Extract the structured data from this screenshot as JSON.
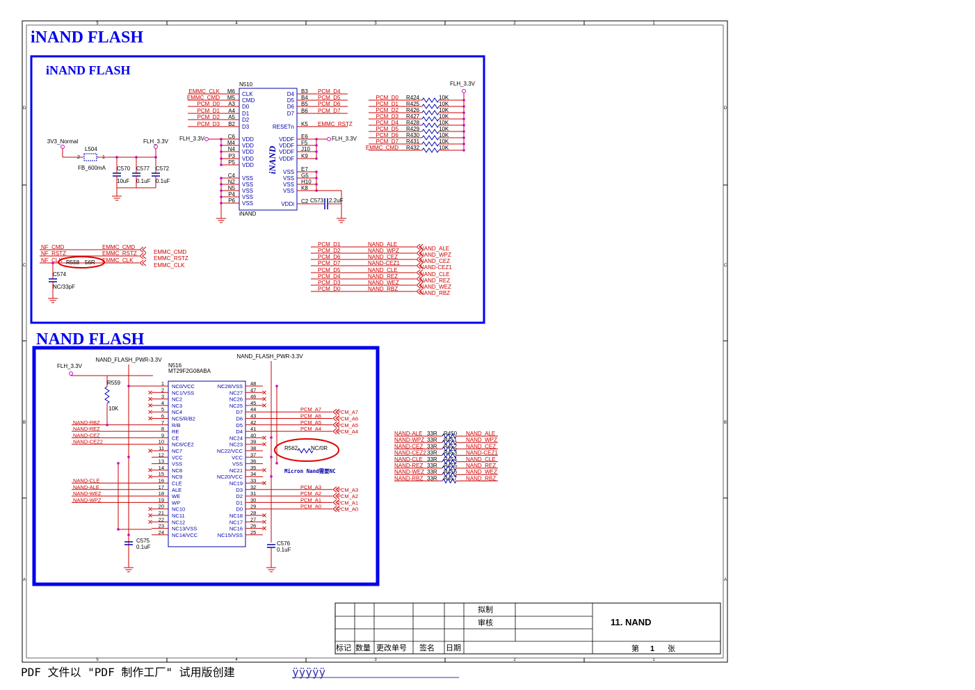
{
  "colors": {
    "wire": "#cc0000",
    "sym": "#0000aa",
    "frame": "#0000ee",
    "pin": "#cc00cc",
    "text": "#000000"
  },
  "border": {
    "cols": [
      "5",
      "4",
      "3",
      "2",
      "1"
    ],
    "rows": [
      "D",
      "C",
      "B",
      "A"
    ]
  },
  "sheet_title": "iNAND FLASH",
  "inand": {
    "title": "iNAND FLASH",
    "ic": {
      "ref": "N510",
      "name": "iNAND",
      "logo": "iNAND"
    },
    "left_pins": [
      {
        "sig": "EMMC_CLK",
        "num": "M6",
        "name": "CLK"
      },
      {
        "sig": "EMMC_CMD",
        "num": "M5",
        "name": "CMD"
      },
      {
        "sig": "PCM_D0",
        "num": "A3",
        "name": "D0"
      },
      {
        "sig": "PCM_D1",
        "num": "A4",
        "name": "D1"
      },
      {
        "sig": "PCM_D2",
        "num": "A5",
        "name": "D2"
      },
      {
        "sig": "PCM_D3",
        "num": "B2",
        "name": "D3"
      },
      {
        "sig": "",
        "num": "C6",
        "name": "VDD"
      },
      {
        "sig": "",
        "num": "M4",
        "name": "VDD"
      },
      {
        "sig": "",
        "num": "N4",
        "name": "VDD"
      },
      {
        "sig": "",
        "num": "P3",
        "name": "VDD"
      },
      {
        "sig": "",
        "num": "P5",
        "name": "VDD"
      },
      {
        "sig": "",
        "num": "C4",
        "name": "VSS"
      },
      {
        "sig": "",
        "num": "N2",
        "name": "VSS"
      },
      {
        "sig": "",
        "num": "N5",
        "name": "VSS"
      },
      {
        "sig": "",
        "num": "P4",
        "name": "VSS"
      },
      {
        "sig": "",
        "num": "P6",
        "name": "VSS"
      }
    ],
    "right_pins": [
      {
        "name": "D4",
        "num": "B3",
        "sig": "PCM_D4"
      },
      {
        "name": "D5",
        "num": "B4",
        "sig": "PCM_D5"
      },
      {
        "name": "D6",
        "num": "B5",
        "sig": "PCM_D6"
      },
      {
        "name": "D7",
        "num": "B6",
        "sig": "PCM_D7"
      },
      {
        "name": "RESETn",
        "num": "K5",
        "sig": "EMMC_RSTZ"
      },
      {
        "name": "VDDF",
        "num": "E6",
        "sig": ""
      },
      {
        "name": "VDDF",
        "num": "F5",
        "sig": ""
      },
      {
        "name": "VDDF",
        "num": "J10",
        "sig": ""
      },
      {
        "name": "VDDF",
        "num": "K9",
        "sig": ""
      },
      {
        "name": "VSS",
        "num": "E7",
        "sig": ""
      },
      {
        "name": "VSS",
        "num": "G5",
        "sig": ""
      },
      {
        "name": "VSS",
        "num": "H10",
        "sig": ""
      },
      {
        "name": "VSS",
        "num": "K8",
        "sig": ""
      },
      {
        "name": "VDDi",
        "num": "C2",
        "sig": ""
      }
    ],
    "power_left": "FLH_3.3V",
    "power_right": "FLH_3.3V",
    "cap_vddi": {
      "ref": "C573",
      "val": "2.2uF"
    },
    "filter": {
      "src": "3V3_Normal",
      "dst": "FLH_3.3V",
      "ind_ref": "L504",
      "ind_val": "FB_600mA",
      "pin2": "2",
      "pin1": "1",
      "caps": [
        {
          "ref": "C570",
          "val": "10uF"
        },
        {
          "ref": "C577",
          "val": "0.1uF"
        },
        {
          "ref": "C572",
          "val": "0.1uF"
        }
      ]
    },
    "pullup_power": "FLH_3.3V",
    "pullups": [
      {
        "net": "PCM_D0",
        "ref": "R424",
        "val": "10K"
      },
      {
        "net": "PCM_D1",
        "ref": "R425",
        "val": "10K"
      },
      {
        "net": "PCM_D2",
        "ref": "R426",
        "val": "10K"
      },
      {
        "net": "PCM_D3",
        "ref": "R427",
        "val": "10K"
      },
      {
        "net": "PCM_D4",
        "ref": "R428",
        "val": "10K"
      },
      {
        "net": "PCM_D5",
        "ref": "R429",
        "val": "10K"
      },
      {
        "net": "PCM_D6",
        "ref": "R430",
        "val": "10K"
      },
      {
        "net": "PCM_D7",
        "ref": "R431",
        "val": "10K"
      },
      {
        "net": "EMMC_CMD",
        "ref": "R432",
        "val": "10K"
      }
    ],
    "map_left": [
      {
        "a": "NF_CMD",
        "b": "EMMC_CMD",
        "out": "EMMC_CMD"
      },
      {
        "a": "NF_RSTZ",
        "b": "EMMC_RSTZ",
        "out": "EMMC_RSTZ"
      },
      {
        "a": "NF_CLK",
        "b": "EMMC_CLK",
        "out": "EMMC_CLK"
      }
    ],
    "series_res": {
      "ref": "R558",
      "val": "56R"
    },
    "clk_cap": {
      "ref": "C574",
      "val": "NC/33pF"
    },
    "map_right": [
      {
        "a": "PCM_D1",
        "b": "NAND_ALE",
        "out": "NAND_ALE"
      },
      {
        "a": "PCM_D2",
        "b": "NAND_WPZ",
        "out": "NAND_WPZ"
      },
      {
        "a": "PCM_D6",
        "b": "NAND_CEZ",
        "out": "NAND_CEZ"
      },
      {
        "a": "PCM_D7",
        "b": "NAND-CEZ1",
        "out": "NAND-CEZ1"
      },
      {
        "a": "PCM_D5",
        "b": "NAND_CLE",
        "out": "NAND_CLE"
      },
      {
        "a": "PCM_D4",
        "b": "NAND_REZ",
        "out": "NAND_REZ"
      },
      {
        "a": "PCM_D3",
        "b": "NAND_WEZ",
        "out": "NAND_WEZ"
      },
      {
        "a": "PCM_D0",
        "b": "NAND_RBZ",
        "out": "NAND_RBZ"
      }
    ]
  },
  "nand": {
    "title": "NAND FLASH",
    "ic": {
      "ref": "N516",
      "part": "MT29F2G08ABA"
    },
    "power_left": "NAND_FLASH_PWR-3.3V",
    "power_right": "NAND_FLASH_PWR-3.3V",
    "flh": "FLH_3.3V",
    "pullup": {
      "ref": "R559",
      "val": "10K"
    },
    "left_pins": [
      {
        "n": "1",
        "name": "NC0/VCC",
        "sig": ""
      },
      {
        "n": "2",
        "name": "NC1/VSS",
        "sig": ""
      },
      {
        "n": "3",
        "name": "NC2",
        "sig": ""
      },
      {
        "n": "4",
        "name": "NC3",
        "sig": ""
      },
      {
        "n": "5",
        "name": "NC4",
        "sig": ""
      },
      {
        "n": "6",
        "name": "NC5/R/B2",
        "sig": ""
      },
      {
        "n": "7",
        "name": "R/B",
        "sig": "NAND-RBZ"
      },
      {
        "n": "8",
        "name": "RE",
        "sig": "NAND-REZ"
      },
      {
        "n": "9",
        "name": "CE",
        "sig": "NAND-CEZ"
      },
      {
        "n": "10",
        "name": "NC6/CE2",
        "sig": "NAND-CEZ2"
      },
      {
        "n": "11",
        "name": "NC7",
        "sig": ""
      },
      {
        "n": "12",
        "name": "VCC",
        "sig": ""
      },
      {
        "n": "13",
        "name": "VSS",
        "sig": ""
      },
      {
        "n": "14",
        "name": "NC8",
        "sig": ""
      },
      {
        "n": "15",
        "name": "NC9",
        "sig": ""
      },
      {
        "n": "16",
        "name": "CLE",
        "sig": "NAND-CLE"
      },
      {
        "n": "17",
        "name": "ALE",
        "sig": "NAND-ALE"
      },
      {
        "n": "18",
        "name": "WE",
        "sig": "NAND-WEZ"
      },
      {
        "n": "19",
        "name": "WP",
        "sig": "NAND-WPZ"
      },
      {
        "n": "20",
        "name": "NC10",
        "sig": ""
      },
      {
        "n": "21",
        "name": "NC11",
        "sig": ""
      },
      {
        "n": "22",
        "name": "NC12",
        "sig": ""
      },
      {
        "n": "23",
        "name": "NC13/VSS",
        "sig": ""
      },
      {
        "n": "24",
        "name": "NC14/VCC",
        "sig": ""
      }
    ],
    "right_pins": [
      {
        "n": "48",
        "name": "NC28/VSS",
        "sig": ""
      },
      {
        "n": "47",
        "name": "NC27",
        "sig": ""
      },
      {
        "n": "46",
        "name": "NC26",
        "sig": ""
      },
      {
        "n": "45",
        "name": "NC25",
        "sig": ""
      },
      {
        "n": "44",
        "name": "D7",
        "sig": "PCM_A7"
      },
      {
        "n": "43",
        "name": "D6",
        "sig": "PCM_A6"
      },
      {
        "n": "42",
        "name": "D5",
        "sig": "PCM_A5"
      },
      {
        "n": "41",
        "name": "D4",
        "sig": "PCM_A4"
      },
      {
        "n": "40",
        "name": "NC24",
        "sig": ""
      },
      {
        "n": "39",
        "name": "NC23",
        "sig": ""
      },
      {
        "n": "38",
        "name": "NC22/VCC",
        "sig": ""
      },
      {
        "n": "37",
        "name": "VCC",
        "sig": ""
      },
      {
        "n": "36",
        "name": "VSS",
        "sig": ""
      },
      {
        "n": "35",
        "name": "NC21",
        "sig": ""
      },
      {
        "n": "34",
        "name": "NC20/VCC",
        "sig": ""
      },
      {
        "n": "33",
        "name": "NC19",
        "sig": ""
      },
      {
        "n": "32",
        "name": "D3",
        "sig": "PCM_A3"
      },
      {
        "n": "31",
        "name": "D2",
        "sig": "PCM_A2"
      },
      {
        "n": "30",
        "name": "D1",
        "sig": "PCM_A1"
      },
      {
        "n": "29",
        "name": "D0",
        "sig": "PCM_A0"
      },
      {
        "n": "28",
        "name": "NC18",
        "sig": ""
      },
      {
        "n": "27",
        "name": "NC17",
        "sig": ""
      },
      {
        "n": "26",
        "name": "NC16",
        "sig": ""
      },
      {
        "n": "25",
        "name": "NC15/VSS",
        "sig": ""
      }
    ],
    "cap_left": {
      "ref": "C575",
      "val": "0.1uF"
    },
    "cap_right": {
      "ref": "C576",
      "val": "0.1uF"
    },
    "r562": {
      "ref": "R562",
      "val": "NC/0R"
    },
    "note": "Micron Nand需要NC",
    "series": [
      {
        "in": "NAND-ALE",
        "val": "33R",
        "ref": "R450",
        "out": "NAND_ALE"
      },
      {
        "in": "NAND-WPZ",
        "val": "33R",
        "ref": "R451",
        "out": "NAND_WPZ"
      },
      {
        "in": "NAND-CEZ",
        "val": "33R",
        "ref": "R452",
        "out": "NAND_CEZ"
      },
      {
        "in": "NAND-CEZ2",
        "val": "33R",
        "ref": "R453",
        "out": "NAND-CEZ1"
      },
      {
        "in": "NAND-CLE",
        "val": "33R",
        "ref": "R454",
        "out": "NAND_CLE"
      },
      {
        "in": "NAND-REZ",
        "val": "33R",
        "ref": "R455",
        "out": "NAND_REZ"
      },
      {
        "in": "NAND-WEZ",
        "val": "33R",
        "ref": "R456",
        "out": "NAND_WEZ"
      },
      {
        "in": "NAND-RBZ",
        "val": "33R",
        "ref": "R457",
        "out": "NAND_RBZ"
      }
    ]
  },
  "title_block": {
    "drawn": "拟制",
    "review": "审核",
    "title": "11. NAND",
    "cols": [
      "标记",
      "数量",
      "更改单号",
      "签名",
      "日期"
    ],
    "page_prefix": "第",
    "page": "1",
    "page_suffix": "张"
  },
  "footer": {
    "text": "PDF 文件以 \"PDF 制作工厂\" 试用版创建",
    "link": "ÿÿÿÿÿ"
  }
}
